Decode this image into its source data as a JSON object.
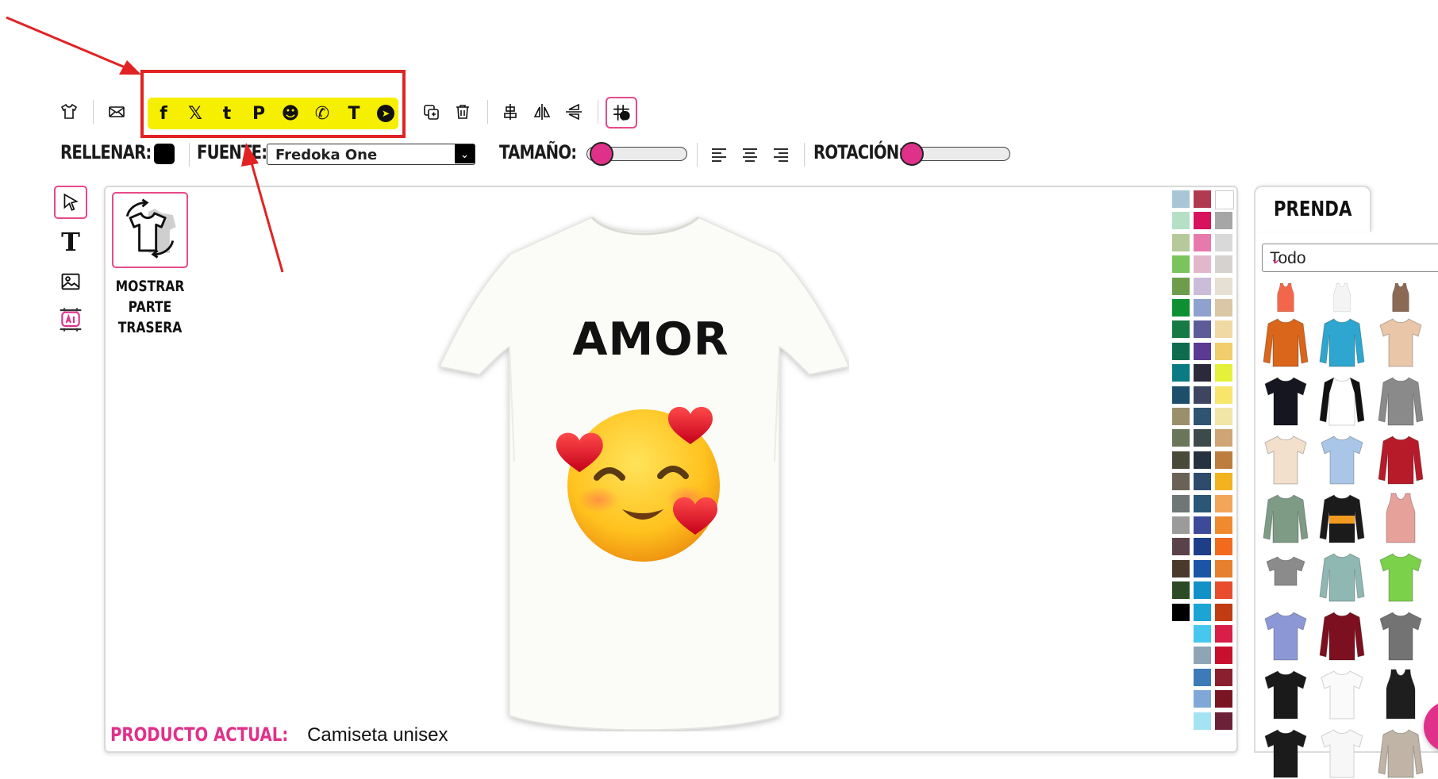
{
  "toolbar": {
    "icons": [
      "tshirt-icon",
      "mail-icon",
      "copy-icon",
      "trash-icon",
      "align-vertical-icon",
      "flip-horizontal-icon",
      "flip-vertical-icon",
      "grid-icon"
    ],
    "social": [
      {
        "name": "facebook-icon",
        "glyph": "f"
      },
      {
        "name": "x-twitter-icon",
        "glyph": "𝕏"
      },
      {
        "name": "tumblr-icon",
        "glyph": "t"
      },
      {
        "name": "pinterest-icon",
        "glyph": "P"
      },
      {
        "name": "reddit-icon",
        "glyph": "☻"
      },
      {
        "name": "whatsapp-icon",
        "glyph": "✆"
      },
      {
        "name": "teams-icon",
        "glyph": "T"
      },
      {
        "name": "telegram-icon",
        "glyph": "➤"
      }
    ]
  },
  "options": {
    "fill_label": "RELLENAR:",
    "fill_color": "#000000",
    "font_label": "FUENTE:",
    "font_value": "Fredoka One",
    "size_label": "TAMAÑO:",
    "size_value": 0,
    "rotation_label": "ROTACIÓN:",
    "rotation_value": 0
  },
  "tools": [
    "select-tool",
    "text-tool",
    "image-tool",
    "ai-tool"
  ],
  "canvas": {
    "back_button_label_1": "MOSTRAR",
    "back_button_label_2": "PARTE",
    "back_button_label_3": "TRASERA",
    "design_text": "AMOR",
    "product_label": "PRODUCTO ACTUAL:",
    "product_value": " Camiseta unisex"
  },
  "palette": {
    "columns": [
      [
        "#a9c6d6",
        "#b5e0c6",
        "#b6c99a",
        "#7bc35c",
        "#6d9d4b",
        "#0f8f33",
        "#177a45",
        "#0f6b4e",
        "#0a7b83",
        "#1d4f6b",
        "#9a8f6b",
        "#6a7559",
        "#4a4a3a",
        "#6b6257",
        "#707676",
        "#9b9b9b",
        "#5b4149",
        "#4b3a2c",
        "#2c4a25",
        "#000000"
      ],
      [
        "#b23a50",
        "#d6135c",
        "#e879ad",
        "#e3b7cb",
        "#cbbcd9",
        "#8ea1cf",
        "#5c5c99",
        "#5b3a94",
        "#2c2a3a",
        "#3d4560",
        "#2f5472",
        "#3c4a4a",
        "#273241",
        "#2e4b6e",
        "#2a5677",
        "#3d4a9a",
        "#1f3e8a",
        "#1d55a6",
        "#1291c6",
        "#1aa5d4",
        "#46c7ee",
        "#8fa5b6",
        "#3d7ab8",
        "#7fa8d6",
        "#a4e3f3"
      ],
      [
        "#ffffff",
        "#a6a6a6",
        "#d9d9d9",
        "#d6d2cf",
        "#e6e0d2",
        "#d9c7a6",
        "#f0d9a3",
        "#f1cd6b",
        "#e5f03a",
        "#f7e66b",
        "#f0e6a6",
        "#cfa575",
        "#bc7d3e",
        "#f2b31f",
        "#f2a65a",
        "#f08a2f",
        "#f06b1e",
        "#e6802e",
        "#e84d2d",
        "#c13c13",
        "#d91f47",
        "#c8102e",
        "#8a1f2f",
        "#7a1524",
        "#6b2238"
      ]
    ]
  },
  "right_panel": {
    "tab_label": "PRENDA",
    "category": "Todo"
  },
  "garments": [
    {
      "name": "tank-top-coral",
      "color": "#f2674b"
    },
    {
      "name": "tank-top-white",
      "color": "#f4f4f4"
    },
    {
      "name": "tank-top-brown",
      "color": "#8a6a55"
    },
    {
      "name": "hoodie-orange",
      "color": "#d9661a"
    },
    {
      "name": "hoodie-turquoise",
      "color": "#2ea6cf"
    },
    {
      "name": "tie-dye-shirt",
      "color": "#e9c6a8"
    },
    {
      "name": "tshirt-navy",
      "color": "#15161f"
    },
    {
      "name": "raglan-white-black",
      "color": "#ffffff"
    },
    {
      "name": "hoodie-grey",
      "color": "#8a8a8a"
    },
    {
      "name": "tshirt-cream",
      "color": "#f2e0cc"
    },
    {
      "name": "tshirt-gradient-blue",
      "color": "#a9c6e8"
    },
    {
      "name": "varsity-jacket-red",
      "color": "#b71b2a"
    },
    {
      "name": "longsleeve-sage",
      "color": "#7e9b86"
    },
    {
      "name": "hoodie-black-orange",
      "color": "#1b1b1b"
    },
    {
      "name": "tank-top-pink",
      "color": "#e7a19b"
    },
    {
      "name": "crop-top-grey",
      "color": "#8b8b8b"
    },
    {
      "name": "sweatshirt-gradient",
      "color": "#8fb8b3"
    },
    {
      "name": "polo-green",
      "color": "#7bd24a"
    },
    {
      "name": "tshirt-lavender",
      "color": "#8c98d6"
    },
    {
      "name": "longsleeve-burgundy",
      "color": "#7d1020"
    },
    {
      "name": "tshirt-grey",
      "color": "#737373"
    },
    {
      "name": "tshirt-black",
      "color": "#1a1a1a"
    },
    {
      "name": "tshirt-white",
      "color": "#fafafa"
    },
    {
      "name": "tank-top-black",
      "color": "#1e1e1e"
    },
    {
      "name": "tshirt-black-2",
      "color": "#1b1b1b"
    },
    {
      "name": "tshirt-white-2",
      "color": "#f7f7f7"
    },
    {
      "name": "sweater-beige",
      "color": "#bfb4a5"
    }
  ]
}
